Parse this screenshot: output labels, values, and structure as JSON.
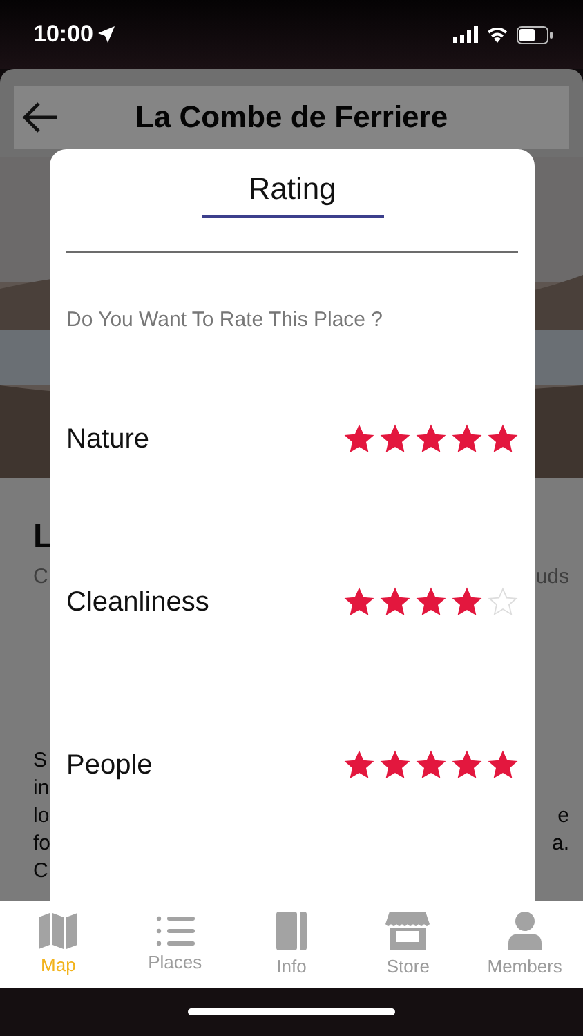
{
  "status_bar": {
    "time": "10:00"
  },
  "header": {
    "title": "La Combe de Ferriere"
  },
  "background_fragments": [
    {
      "kind": "title",
      "left": "L"
    },
    {
      "kind": "subtitle",
      "left": "C",
      "right": "uds"
    },
    {
      "kind": "text",
      "left": "S"
    },
    {
      "kind": "text",
      "left": "in"
    },
    {
      "kind": "text",
      "left": "lo",
      "right": "e"
    },
    {
      "kind": "text",
      "left": "fo",
      "right": "a."
    },
    {
      "kind": "text",
      "left": "C"
    }
  ],
  "dialog": {
    "title": "Rating",
    "prompt": "Do You Want To Rate This Place ?",
    "ratings": [
      {
        "label": "Nature",
        "stars": 5
      },
      {
        "label": "Cleanliness",
        "stars": 4
      },
      {
        "label": "People",
        "stars": 5
      }
    ]
  },
  "tab_bar": [
    {
      "label": "Map",
      "selected": true
    },
    {
      "label": "Places",
      "selected": false
    },
    {
      "label": "Info",
      "selected": false
    },
    {
      "label": "Store",
      "selected": false
    },
    {
      "label": "Members",
      "selected": false
    }
  ]
}
